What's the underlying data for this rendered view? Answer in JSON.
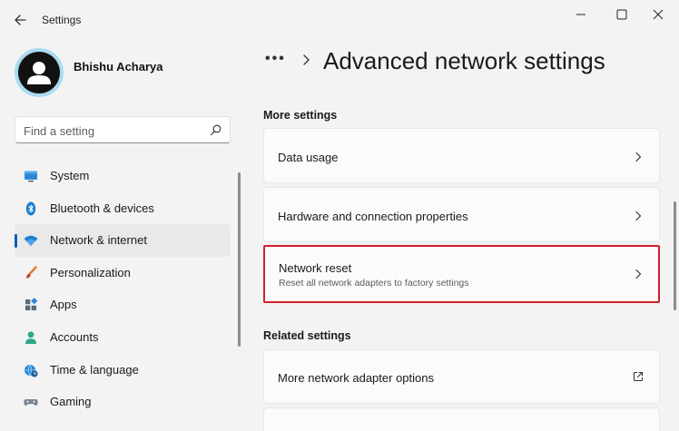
{
  "window": {
    "title": "Settings"
  },
  "user": {
    "name": "Bhishu Acharya"
  },
  "search": {
    "placeholder": "Find a setting"
  },
  "sidebar": {
    "items": [
      {
        "label": "System",
        "icon": "monitor-icon"
      },
      {
        "label": "Bluetooth & devices",
        "icon": "bluetooth-icon"
      },
      {
        "label": "Network & internet",
        "icon": "wifi-icon",
        "active": true
      },
      {
        "label": "Personalization",
        "icon": "brush-icon"
      },
      {
        "label": "Apps",
        "icon": "apps-icon"
      },
      {
        "label": "Accounts",
        "icon": "person-icon"
      },
      {
        "label": "Time & language",
        "icon": "globe-clock-icon"
      },
      {
        "label": "Gaming",
        "icon": "gamepad-icon"
      }
    ]
  },
  "breadcrumb": {
    "more": "•••",
    "title": "Advanced network settings"
  },
  "sections": {
    "more_settings": {
      "header": "More settings",
      "cards": [
        {
          "title": "Data usage"
        },
        {
          "title": "Hardware and connection properties"
        },
        {
          "title": "Network reset",
          "subtitle": "Reset all network adapters to factory settings",
          "highlighted": true
        }
      ]
    },
    "related_settings": {
      "header": "Related settings",
      "cards": [
        {
          "title": "More network adapter options"
        }
      ]
    }
  },
  "colors": {
    "accent": "#005fb8",
    "highlight": "#d0202a",
    "avatar_ring": "#a9dcf0"
  }
}
